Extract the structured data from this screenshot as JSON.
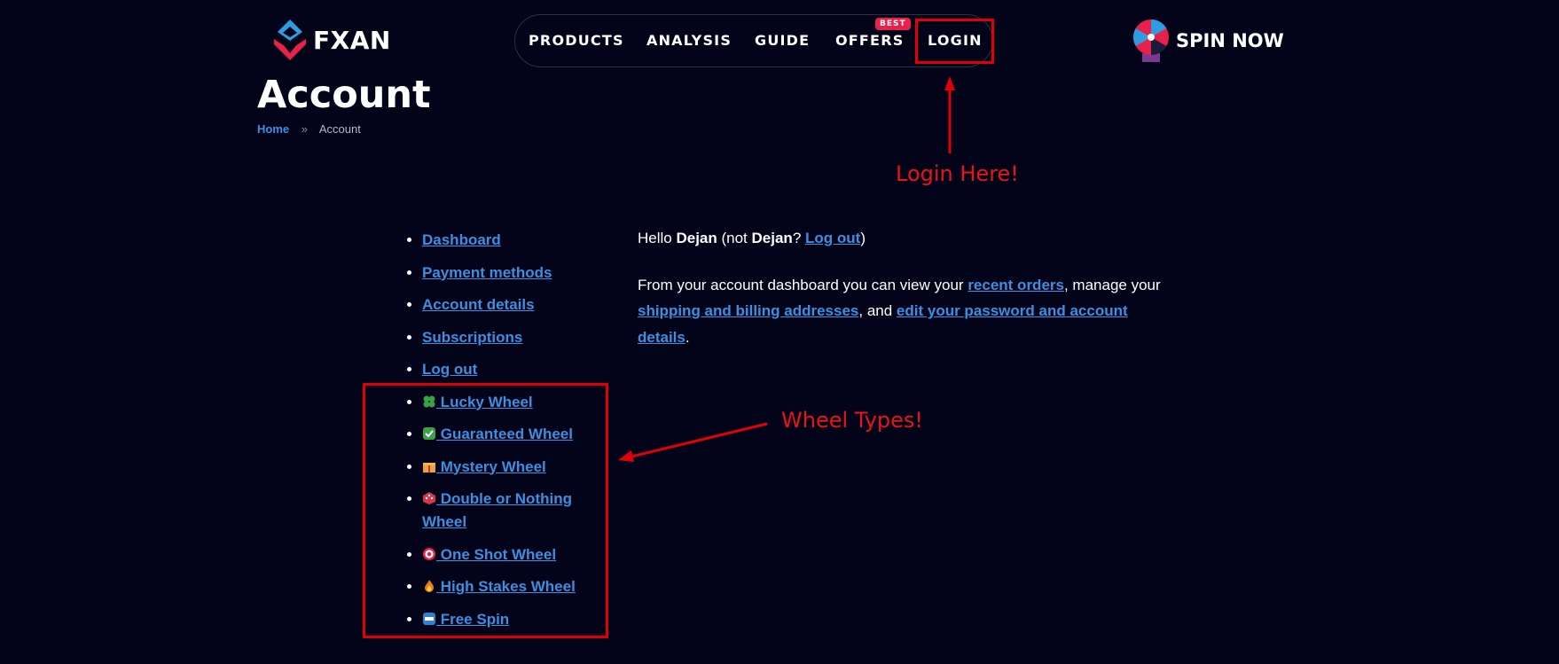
{
  "brand": {
    "name": "FXAN"
  },
  "nav": {
    "items": [
      {
        "label": "PRODUCTS"
      },
      {
        "label": "ANALYSIS"
      },
      {
        "label": "GUIDE"
      },
      {
        "label": "OFFERS"
      },
      {
        "label": "LOGIN"
      }
    ],
    "offers_badge": "BEST"
  },
  "spin": {
    "label": "SPIN NOW"
  },
  "page": {
    "title": "Account"
  },
  "breadcrumb": {
    "home": "Home",
    "separator": "»",
    "current": "Account"
  },
  "account_menu": [
    {
      "label": "Dashboard"
    },
    {
      "label": "Payment methods"
    },
    {
      "label": "Account details"
    },
    {
      "label": "Subscriptions"
    },
    {
      "label": "Log out"
    },
    {
      "label": " Lucky Wheel",
      "icon": "four-leaf-clover-icon"
    },
    {
      "label": " Guaranteed Wheel",
      "icon": "check-mark-button-icon"
    },
    {
      "label": " Mystery Wheel",
      "icon": "gift-icon"
    },
    {
      "label": " Double or Nothing Wheel",
      "icon": "dice-icon"
    },
    {
      "label": " One Shot Wheel",
      "icon": "target-icon"
    },
    {
      "label": " High Stakes Wheel",
      "icon": "fire-icon"
    },
    {
      "label": " Free Spin",
      "icon": "free-button-icon"
    }
  ],
  "greeting": {
    "hello": "Hello ",
    "user": "Dejan",
    "not": " (not ",
    "user2": "Dejan",
    "question": "? ",
    "logout": "Log out",
    "close": ")"
  },
  "dashboard_text": {
    "t1": "From your account dashboard you can view your ",
    "link1": "recent orders",
    "t2": ", manage your ",
    "link2": "shipping and billing addresses",
    "t3": ", and ",
    "link3": "edit your password and account details",
    "t4": "."
  },
  "annotations": {
    "login": "Login Here!",
    "wheels": "Wheel Types!"
  },
  "colors": {
    "background": "#03031a",
    "link": "#3d8fe0",
    "badge": "#e8214b",
    "annotation": "#e10009"
  }
}
